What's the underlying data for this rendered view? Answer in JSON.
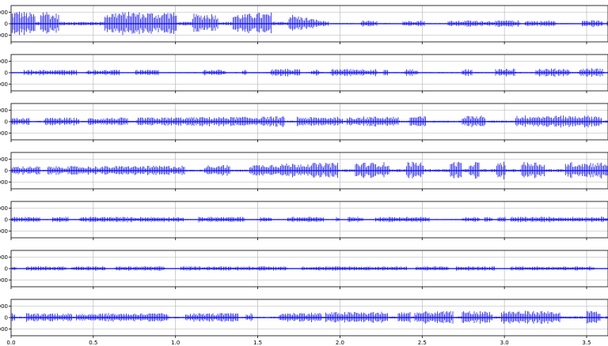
{
  "chart_data": {
    "type": "line",
    "title": "",
    "xlabel": "",
    "ylabel": "",
    "grid": true,
    "line_color": "#0000ff",
    "xlim": [
      0.0,
      3.63
    ],
    "x_ticks": [
      0.0,
      0.5,
      1.0,
      1.5,
      2.0,
      2.5,
      3.0,
      3.5
    ],
    "x_tick_labels": [
      "0.0",
      "0.5",
      "1.0",
      "1.5",
      "2.0",
      "2.5",
      "3.0",
      "3.5"
    ],
    "y_ticks": [
      -1000,
      0,
      1000
    ],
    "y_tick_labels": [
      "000",
      "0",
      "000"
    ],
    "panels": [
      {
        "ylim": [
          -1600,
          1600
        ],
        "envelope": [
          [
            0.0,
            1100
          ],
          [
            0.05,
            1150
          ],
          [
            0.1,
            1050
          ],
          [
            0.15,
            900
          ],
          [
            0.2,
            1300
          ],
          [
            0.25,
            900
          ],
          [
            0.3,
            1000
          ],
          [
            0.35,
            1050
          ],
          [
            0.4,
            900
          ],
          [
            0.45,
            1100
          ],
          [
            0.5,
            1050
          ],
          [
            0.55,
            1000
          ],
          [
            0.6,
            1000
          ],
          [
            0.65,
            1100
          ],
          [
            0.7,
            1050
          ],
          [
            0.75,
            1100
          ],
          [
            0.8,
            1000
          ],
          [
            0.85,
            1050
          ],
          [
            0.9,
            1000
          ],
          [
            0.95,
            1100
          ],
          [
            1.0,
            1000
          ],
          [
            1.05,
            950
          ],
          [
            1.1,
            900
          ],
          [
            1.15,
            850
          ],
          [
            1.2,
            950
          ],
          [
            1.25,
            900
          ],
          [
            1.3,
            1000
          ],
          [
            1.35,
            900
          ],
          [
            1.4,
            850
          ],
          [
            1.45,
            900
          ],
          [
            1.5,
            1000
          ],
          [
            1.55,
            950
          ],
          [
            1.6,
            1050
          ],
          [
            1.65,
            1000
          ],
          [
            1.7,
            850
          ],
          [
            1.75,
            700
          ],
          [
            1.8,
            550
          ],
          [
            1.85,
            400
          ],
          [
            1.9,
            250
          ],
          [
            1.95,
            250
          ],
          [
            2.0,
            300
          ],
          [
            2.1,
            300
          ],
          [
            2.2,
            250
          ],
          [
            2.3,
            300
          ],
          [
            2.4,
            250
          ],
          [
            2.5,
            300
          ],
          [
            2.6,
            300
          ],
          [
            2.7,
            250
          ],
          [
            2.8,
            300
          ],
          [
            2.9,
            250
          ],
          [
            3.0,
            300
          ],
          [
            3.1,
            300
          ],
          [
            3.2,
            250
          ],
          [
            3.3,
            300
          ],
          [
            3.4,
            300
          ],
          [
            3.5,
            300
          ],
          [
            3.63,
            300
          ]
        ]
      },
      {
        "ylim": [
          -1600,
          1600
        ],
        "envelope": [
          [
            0.0,
            250
          ],
          [
            0.5,
            250
          ],
          [
            1.0,
            250
          ],
          [
            1.5,
            300
          ],
          [
            1.7,
            350
          ],
          [
            1.85,
            300
          ],
          [
            2.0,
            350
          ],
          [
            2.5,
            300
          ],
          [
            3.0,
            350
          ],
          [
            3.5,
            400
          ],
          [
            3.63,
            400
          ]
        ]
      },
      {
        "ylim": [
          -1600,
          1600
        ],
        "envelope": [
          [
            0.0,
            350
          ],
          [
            0.5,
            350
          ],
          [
            1.0,
            400
          ],
          [
            1.5,
            450
          ],
          [
            1.7,
            500
          ],
          [
            1.85,
            400
          ],
          [
            2.0,
            450
          ],
          [
            2.5,
            500
          ],
          [
            3.0,
            550
          ],
          [
            3.5,
            550
          ],
          [
            3.63,
            550
          ]
        ]
      },
      {
        "ylim": [
          -1600,
          1600
        ],
        "envelope": [
          [
            0.0,
            400
          ],
          [
            0.5,
            400
          ],
          [
            1.0,
            450
          ],
          [
            1.5,
            550
          ],
          [
            1.7,
            650
          ],
          [
            1.85,
            700
          ],
          [
            2.0,
            700
          ],
          [
            2.5,
            800
          ],
          [
            3.0,
            800
          ],
          [
            3.5,
            750
          ],
          [
            3.63,
            750
          ]
        ]
      },
      {
        "ylim": [
          -1600,
          1600
        ],
        "envelope": [
          [
            0.0,
            250
          ],
          [
            0.5,
            250
          ],
          [
            1.0,
            250
          ],
          [
            1.5,
            250
          ],
          [
            2.0,
            250
          ],
          [
            2.5,
            250
          ],
          [
            3.0,
            250
          ],
          [
            3.5,
            250
          ],
          [
            3.63,
            250
          ]
        ]
      },
      {
        "ylim": [
          -1600,
          1600
        ],
        "envelope": [
          [
            0.0,
            200
          ],
          [
            0.5,
            200
          ],
          [
            1.0,
            200
          ],
          [
            1.5,
            200
          ],
          [
            2.0,
            200
          ],
          [
            2.5,
            200
          ],
          [
            3.0,
            200
          ],
          [
            3.5,
            200
          ],
          [
            3.63,
            200
          ]
        ]
      },
      {
        "ylim": [
          -1600,
          1600
        ],
        "envelope": [
          [
            0.0,
            400
          ],
          [
            0.5,
            400
          ],
          [
            1.0,
            400
          ],
          [
            1.5,
            400
          ],
          [
            1.8,
            450
          ],
          [
            2.0,
            500
          ],
          [
            2.5,
            550
          ],
          [
            3.0,
            600
          ],
          [
            3.5,
            600
          ],
          [
            3.63,
            600
          ]
        ]
      }
    ]
  }
}
